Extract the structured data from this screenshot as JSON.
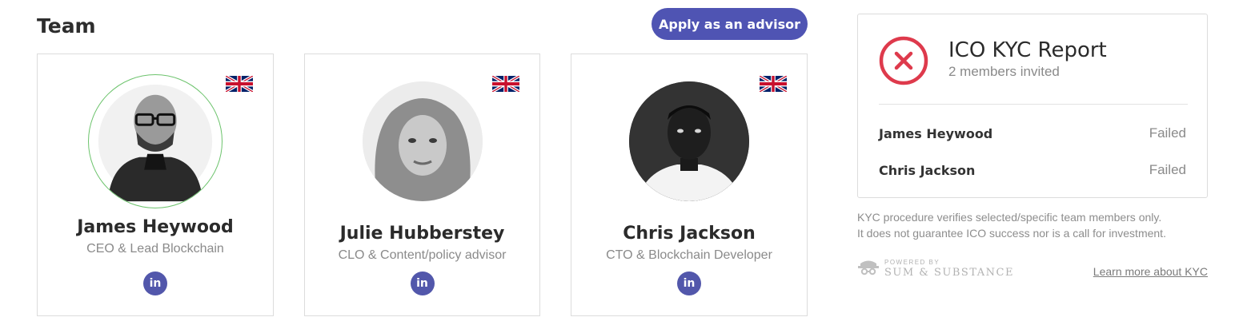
{
  "team": {
    "title": "Team",
    "apply_label": "Apply as an advisor",
    "members": [
      {
        "name": "James Heywood",
        "role": "CEO & Lead Blockchain",
        "country": "United Kingdom",
        "linkedin_label": "in"
      },
      {
        "name": "Julie Hubberstey",
        "role": "CLO & Content/policy advisor",
        "country": "United Kingdom",
        "linkedin_label": "in"
      },
      {
        "name": "Chris Jackson",
        "role": "CTO & Blockchain Developer",
        "country": "United Kingdom",
        "linkedin_label": "in"
      }
    ]
  },
  "kyc": {
    "title": "ICO KYC Report",
    "subtitle": "2 members invited",
    "icon": "x-circle-icon",
    "rows": [
      {
        "name": "James Heywood",
        "status": "Failed"
      },
      {
        "name": "Chris Jackson",
        "status": "Failed"
      }
    ],
    "disclaimer_line1": "KYC procedure verifies selected/specific team members only.",
    "disclaimer_line2": "It does not guarantee ICO success nor is a call for investment.",
    "powered_by": "POWERED BY",
    "provider": "SUM & SUBSTANCE",
    "learn_more": "Learn more about KYC"
  },
  "colors": {
    "accent": "#4f54b3",
    "failed": "#de3a4c",
    "highlight_ring": "#6cc36c"
  }
}
